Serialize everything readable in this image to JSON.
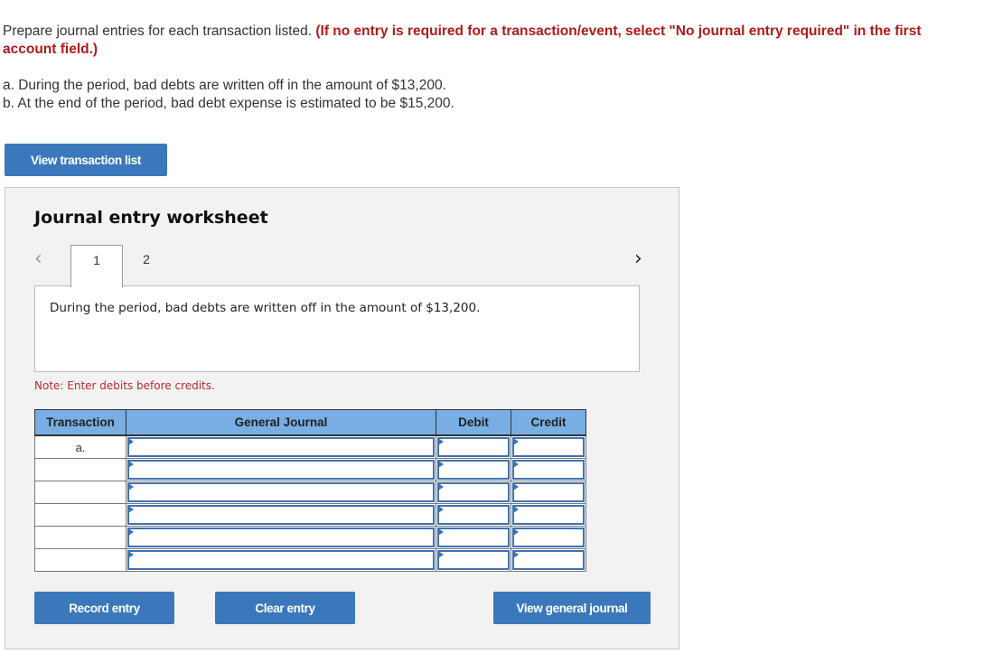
{
  "instructions": {
    "text": "Prepare journal entries for each transaction listed. ",
    "emphasis": "(If no entry is required for a transaction/event, select \"No journal entry required\" in the first account field.)"
  },
  "transactions": [
    "a. During the period, bad debts are written off in the amount of $13,200.",
    "b. At the end of the period, bad debt expense is estimated to be $15,200."
  ],
  "buttons": {
    "view_transaction_list": "View transaction list",
    "record_entry": "Record entry",
    "clear_entry": "Clear entry",
    "view_general_journal": "View general journal"
  },
  "worksheet": {
    "title": "Journal entry worksheet",
    "nav_prev_icon": "‹",
    "nav_next_icon": "›",
    "tabs": [
      "1",
      "2"
    ],
    "active_tab": "1",
    "description": "During the period, bad debts are written off in the amount of $13,200.",
    "note": "Note: Enter debits before credits.",
    "table": {
      "headers": [
        "Transaction",
        "General Journal",
        "Debit",
        "Credit"
      ],
      "rows": [
        {
          "transaction": "a.",
          "account": "",
          "debit": "",
          "credit": ""
        },
        {
          "transaction": "",
          "account": "",
          "debit": "",
          "credit": ""
        },
        {
          "transaction": "",
          "account": "",
          "debit": "",
          "credit": ""
        },
        {
          "transaction": "",
          "account": "",
          "debit": "",
          "credit": ""
        },
        {
          "transaction": "",
          "account": "",
          "debit": "",
          "credit": ""
        },
        {
          "transaction": "",
          "account": "",
          "debit": "",
          "credit": ""
        }
      ]
    }
  },
  "colors": {
    "button_blue": "#3a78bb",
    "header_blue": "#78aee3",
    "emphasis_red": "#b01a1a",
    "note_red": "#c0282d"
  }
}
